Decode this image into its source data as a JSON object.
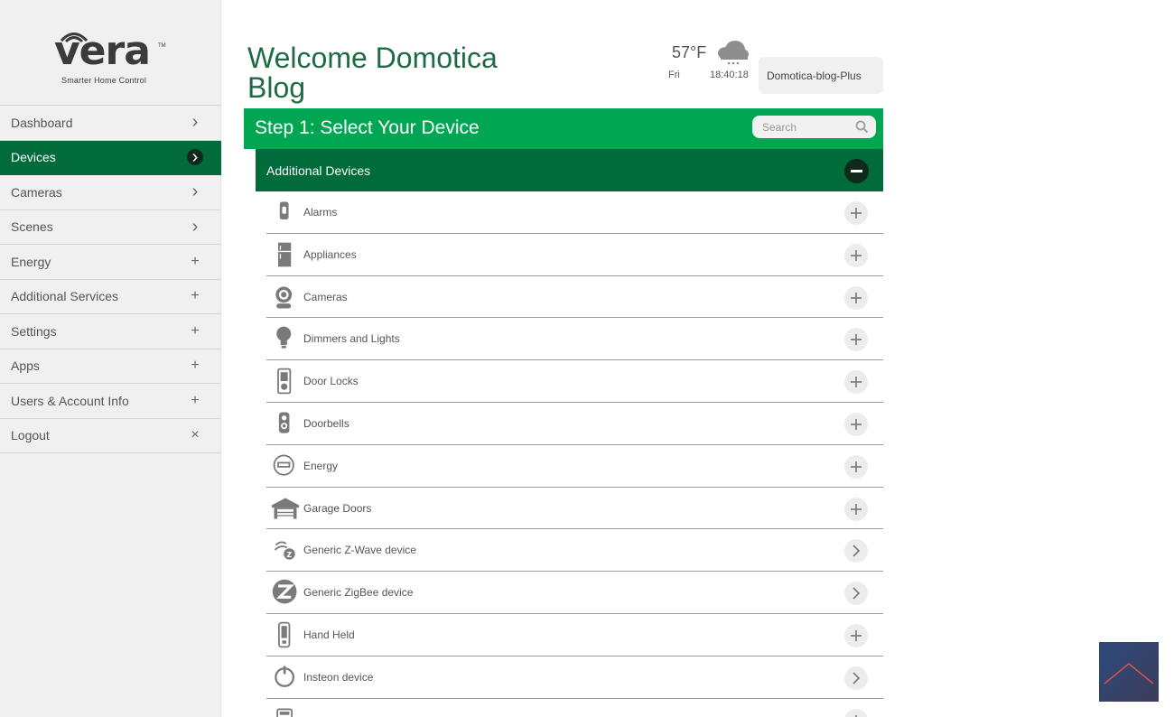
{
  "brand": {
    "name": "vera",
    "trademark": "TM",
    "tagline": "Smarter Home Control"
  },
  "sidebar": {
    "items": [
      {
        "label": "Dashboard",
        "glyph": "chevron-right",
        "active": false
      },
      {
        "label": "Devices",
        "glyph": "chevron-right",
        "active": true
      },
      {
        "label": "Cameras",
        "glyph": "chevron-right",
        "active": false
      },
      {
        "label": "Scenes",
        "glyph": "chevron-right",
        "active": false
      },
      {
        "label": "Energy",
        "glyph": "plus",
        "active": false
      },
      {
        "label": "Additional Services",
        "glyph": "plus",
        "active": false
      },
      {
        "label": "Settings",
        "glyph": "plus",
        "active": false
      },
      {
        "label": "Apps",
        "glyph": "plus",
        "active": false
      },
      {
        "label": "Users & Account Info",
        "glyph": "plus",
        "active": false
      },
      {
        "label": "Logout",
        "glyph": "close",
        "active": false
      }
    ]
  },
  "header": {
    "welcome": "Welcome Domotica Blog",
    "weather": {
      "temperature": "57°F",
      "day": "Fri",
      "time": "18:40:18",
      "icon": "cloud-snow-icon"
    },
    "account": "Domotica-blog-Plus"
  },
  "step": {
    "title": "Step 1: Select Your Device",
    "search_placeholder": "Search"
  },
  "section": {
    "title": "Additional Devices"
  },
  "devices": [
    {
      "label": "Alarms",
      "icon": "alarm-icon",
      "action": "plus"
    },
    {
      "label": "Appliances",
      "icon": "appliance-icon",
      "action": "plus"
    },
    {
      "label": "Cameras",
      "icon": "camera-icon",
      "action": "plus"
    },
    {
      "label": "Dimmers and Lights",
      "icon": "bulb-icon",
      "action": "plus"
    },
    {
      "label": "Door Locks",
      "icon": "door-lock-icon",
      "action": "plus"
    },
    {
      "label": "Doorbells",
      "icon": "doorbell-icon",
      "action": "plus"
    },
    {
      "label": "Energy",
      "icon": "energy-meter-icon",
      "action": "plus"
    },
    {
      "label": "Garage Doors",
      "icon": "garage-icon",
      "action": "plus"
    },
    {
      "label": "Generic Z-Wave device",
      "icon": "zwave-icon",
      "action": "chevron"
    },
    {
      "label": "Generic ZigBee device",
      "icon": "zigbee-icon",
      "action": "chevron"
    },
    {
      "label": "Hand Held",
      "icon": "remote-icon",
      "action": "plus"
    },
    {
      "label": "Insteon device",
      "icon": "insteon-icon",
      "action": "chevron"
    },
    {
      "label": "",
      "icon": "keypad-icon",
      "action": "plus"
    }
  ],
  "colors": {
    "green": "#00a651",
    "dark_green": "#006c3b",
    "sidebar_bg": "#f0f0f0"
  }
}
